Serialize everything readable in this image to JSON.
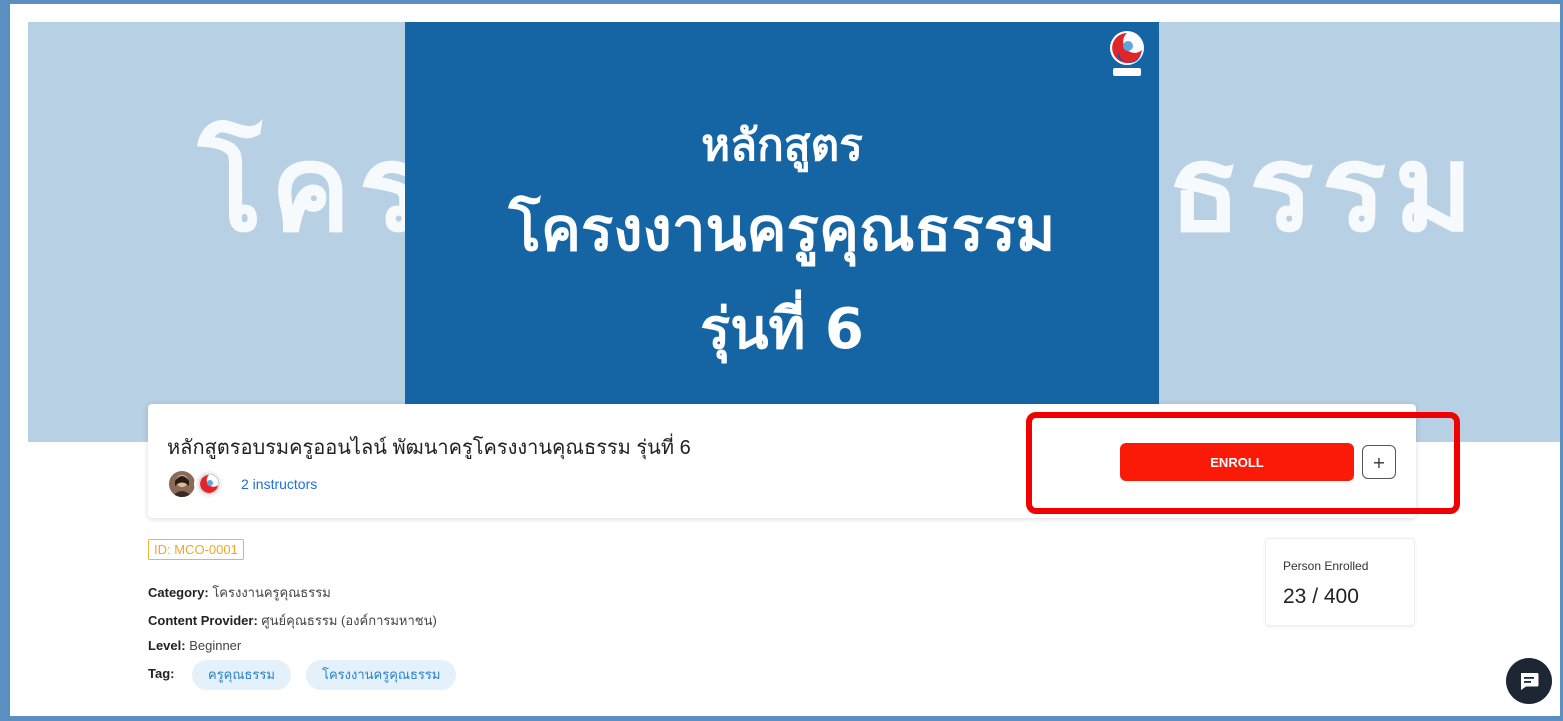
{
  "hero": {
    "ghost_left": "โครง",
    "ghost_right": "ธรรม",
    "line1": "หลักสูตร",
    "line2": "โครงงานครูคุณธรรม",
    "line3": "รุ่นที่ 6"
  },
  "course": {
    "title": "หลักสูตรอบรมครูออนไลน์ พัฒนาครูโครงงานคุณธรรม รุ่นที่ 6",
    "instructors_label": "2 instructors"
  },
  "actions": {
    "enroll_label": "ENROLL",
    "add_label": "+"
  },
  "details": {
    "id_badge": "ID: MCO-0001",
    "category_label": "Category:",
    "category_value": "โครงงานครูคุณธรรม",
    "provider_label": "Content Provider:",
    "provider_value": "ศูนย์คุณธรรม (องค์การมหาชน)",
    "level_label": "Level:",
    "level_value": "Beginner",
    "tag_label": "Tag:",
    "tags": [
      "ครูคุณธรรม",
      "โครงงานครูคุณธรรม"
    ]
  },
  "enrollment": {
    "label": "Person Enrolled",
    "count": "23 / 400"
  },
  "colors": {
    "hero_card": "#1565a5",
    "hero_bg": "#b8d0e3",
    "enroll_button": "#fb1a07",
    "highlight": "#f00000",
    "link": "#1e6fd9",
    "badge": "#f0a728"
  },
  "icons": {
    "chat": "chat-icon",
    "logo": "org-logo-icon"
  }
}
